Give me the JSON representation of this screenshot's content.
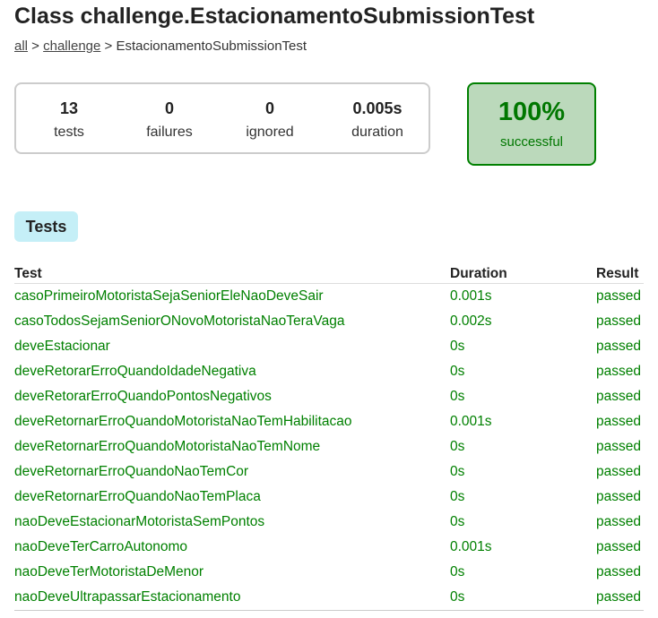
{
  "page": {
    "title": "Class challenge.EstacionamentoSubmissionTest",
    "breadcrumb": {
      "all": "all",
      "sep1": " > ",
      "challenge": "challenge",
      "sep2": " > ",
      "current": "EstacionamentoSubmissionTest"
    }
  },
  "summary": {
    "tests": {
      "value": "13",
      "label": "tests"
    },
    "failures": {
      "value": "0",
      "label": "failures"
    },
    "ignored": {
      "value": "0",
      "label": "ignored"
    },
    "duration": {
      "value": "0.005s",
      "label": "duration"
    },
    "success": {
      "value": "100%",
      "label": "successful"
    }
  },
  "tabs": [
    {
      "label": "Tests"
    }
  ],
  "table": {
    "headers": [
      "Test",
      "Duration",
      "Result"
    ],
    "rows": [
      {
        "test": "casoPrimeiroMotoristaSejaSeniorEleNaoDeveSair",
        "duration": "0.001s",
        "result": "passed"
      },
      {
        "test": "casoTodosSejamSeniorONovoMotoristaNaoTeraVaga",
        "duration": "0.002s",
        "result": "passed"
      },
      {
        "test": "deveEstacionar",
        "duration": "0s",
        "result": "passed"
      },
      {
        "test": "deveRetorarErroQuandoIdadeNegativa",
        "duration": "0s",
        "result": "passed"
      },
      {
        "test": "deveRetorarErroQuandoPontosNegativos",
        "duration": "0s",
        "result": "passed"
      },
      {
        "test": "deveRetornarErroQuandoMotoristaNaoTemHabilitacao",
        "duration": "0.001s",
        "result": "passed"
      },
      {
        "test": "deveRetornarErroQuandoMotoristaNaoTemNome",
        "duration": "0s",
        "result": "passed"
      },
      {
        "test": "deveRetornarErroQuandoNaoTemCor",
        "duration": "0s",
        "result": "passed"
      },
      {
        "test": "deveRetornarErroQuandoNaoTemPlaca",
        "duration": "0s",
        "result": "passed"
      },
      {
        "test": "naoDeveEstacionarMotoristaSemPontos",
        "duration": "0s",
        "result": "passed"
      },
      {
        "test": "naoDeveTerCarroAutonomo",
        "duration": "0.001s",
        "result": "passed"
      },
      {
        "test": "naoDeveTerMotoristaDeMenor",
        "duration": "0s",
        "result": "passed"
      },
      {
        "test": "naoDeveUltrapassarEstacionamento",
        "duration": "0s",
        "result": "passed"
      }
    ]
  },
  "colors": {
    "success_green": "#008000",
    "success_bg": "#bbd9bb",
    "tab_bg": "#c5eff7"
  }
}
